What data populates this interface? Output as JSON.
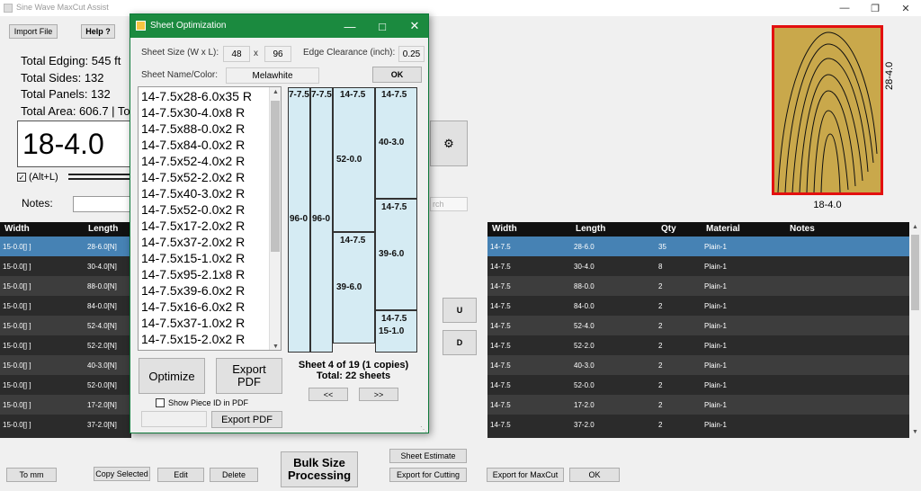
{
  "app": {
    "title": "Sine Wave MaxCut Assist"
  },
  "toolbar": {
    "import": "Import File",
    "help": "Help ?"
  },
  "stats": {
    "edging": "Total Edging: 545 ft",
    "sides": "Total Sides: 132",
    "panels": "Total Panels: 132",
    "area": "Total Area: 606.7 | Tot"
  },
  "size_display": "18-4.0",
  "altl": "(Alt+L)",
  "notes_label": "Notes:",
  "search_placeholder": "rch",
  "left_table": {
    "headers": [
      "Width",
      "Length"
    ],
    "rows": [
      [
        "15-0.0[] ]",
        "28-6.0[N]"
      ],
      [
        "15-0.0[] ]",
        "30-4.0[N]"
      ],
      [
        "15-0.0[] ]",
        "88-0.0[N]"
      ],
      [
        "15-0.0[] ]",
        "84-0.0[N]"
      ],
      [
        "15-0.0[] ]",
        "52-4.0[N]"
      ],
      [
        "15-0.0[] ]",
        "52-2.0[N]"
      ],
      [
        "15-0.0[] ]",
        "40-3.0[N]"
      ],
      [
        "15-0.0[] ]",
        "52-0.0[N]"
      ],
      [
        "15-0.0[] ]",
        "17-2.0[N]"
      ],
      [
        "15-0.0[] ]",
        "37-2.0[N]"
      ]
    ]
  },
  "right_table": {
    "headers": [
      "Width",
      "Length",
      "Qty",
      "Material",
      "Notes"
    ],
    "rows": [
      [
        "14-7.5",
        "28-6.0",
        "35",
        "Plain-1",
        ""
      ],
      [
        "14-7.5",
        "30-4.0",
        "8",
        "Plain-1",
        ""
      ],
      [
        "14-7.5",
        "88-0.0",
        "2",
        "Plain-1",
        ""
      ],
      [
        "14-7.5",
        "84-0.0",
        "2",
        "Plain-1",
        ""
      ],
      [
        "14-7.5",
        "52-4.0",
        "2",
        "Plain-1",
        ""
      ],
      [
        "14-7.5",
        "52-2.0",
        "2",
        "Plain-1",
        ""
      ],
      [
        "14-7.5",
        "40-3.0",
        "2",
        "Plain-1",
        ""
      ],
      [
        "14-7.5",
        "52-0.0",
        "2",
        "Plain-1",
        ""
      ],
      [
        "14-7.5",
        "17-2.0",
        "2",
        "Plain-1",
        ""
      ],
      [
        "14-7.5",
        "37-2.0",
        "2",
        "Plain-1",
        ""
      ]
    ]
  },
  "side_buttons": {
    "up": "U",
    "down": "D"
  },
  "bottom": {
    "to_mm": "To mm",
    "copy": "Copy Selected",
    "edit": "Edit",
    "delete": "Delete",
    "bulk": "Bulk Size Processing",
    "sheet_estimate": "Sheet Estimate",
    "export_cutting": "Export for Cutting",
    "export_maxcut": "Export for MaxCut",
    "ok": "OK"
  },
  "preview": {
    "width_label": "18-4.0",
    "height_label": "28-4.0"
  },
  "dialog": {
    "title": "Sheet Optimization",
    "sheet_size_label": "Sheet Size (W x L):",
    "sheet_w": "48",
    "x": "x",
    "sheet_l": "96",
    "edge_label": "Edge Clearance (inch):",
    "edge_val": "0.25",
    "name_label": "Sheet Name/Color:",
    "name_val": "Melawhite",
    "ok": "OK",
    "pieces": [
      "14-7.5x28-6.0x35 R",
      "14-7.5x30-4.0x8 R",
      "14-7.5x88-0.0x2 R",
      "14-7.5x84-0.0x2 R",
      "14-7.5x52-4.0x2 R",
      "14-7.5x52-2.0x2 R",
      "14-7.5x40-3.0x2 R",
      "14-7.5x52-0.0x2 R",
      "14-7.5x17-2.0x2 R",
      "14-7.5x37-2.0x2 R",
      "14-7.5x15-1.0x2 R",
      "14-7.5x95-2.1x8 R",
      "14-7.5x39-6.0x2 R",
      "14-7.5x16-6.0x2 R",
      "14-7.5x37-1.0x2 R",
      "14-7.5x15-2.0x2 R"
    ],
    "layout": {
      "col1_top": "7-7.5",
      "col1_mid": "96-0",
      "col2_top": "7-7.5",
      "col2_mid": "96-0",
      "col3_a_top": "14-7.5",
      "col3_a_mid": "52-0.0",
      "col3_b_top": "14-7.5",
      "col3_b_mid": "39-6.0",
      "col4_a_top": "14-7.5",
      "col4_a_mid": "40-3.0",
      "col4_b_top": "14-7.5",
      "col4_b_mid": "39-6.0",
      "col4_c_top": "14-7.5",
      "col4_c_mid": "15-1.0"
    },
    "sheet_info": "Sheet 4 of 19 (1 copies)",
    "total_info": "Total: 22 sheets",
    "prev": "<<",
    "next": ">>",
    "optimize": "Optimize",
    "export_pdf_big": "Export PDF",
    "show_piece_id": "Show Piece ID in PDF",
    "export_pdf_small": "Export PDF"
  },
  "colors": {
    "accent": "#1b8a3f",
    "selected": "#4682b4",
    "preview_wood": "#c9a84b",
    "preview_border": "#e31010"
  }
}
